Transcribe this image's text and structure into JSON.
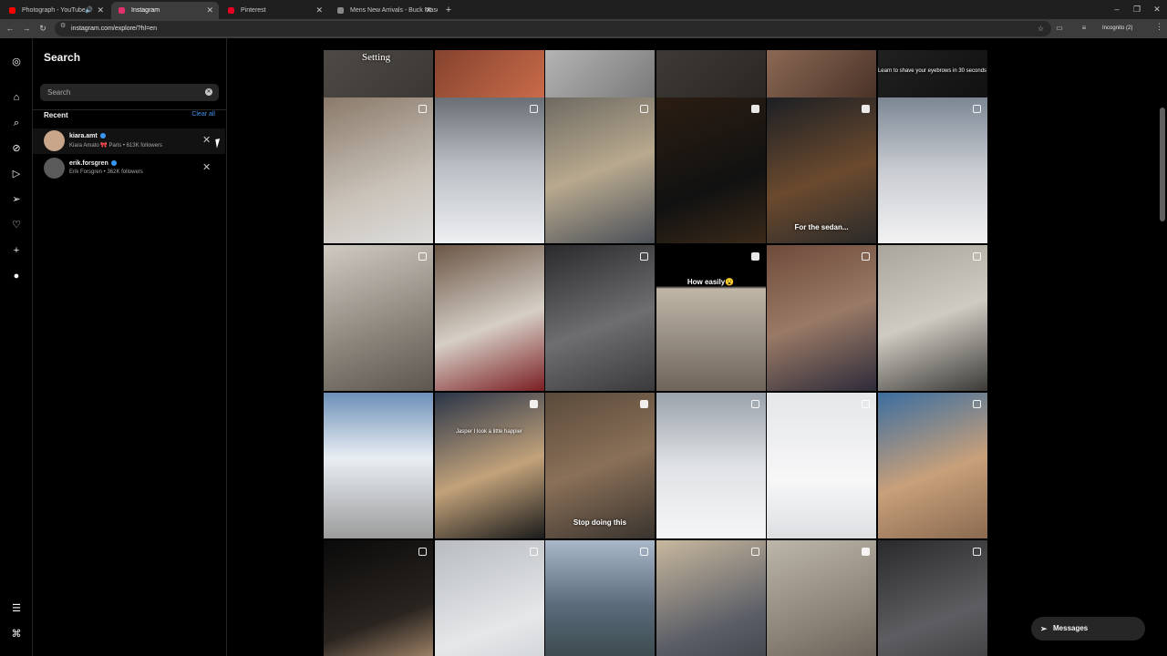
{
  "browser": {
    "tabs": [
      {
        "label": "Photograph - YouTube",
        "favicon_color": "#ff0000",
        "audio": true,
        "active": false
      },
      {
        "label": "Instagram",
        "favicon_color": "#e1306c",
        "audio": false,
        "active": true
      },
      {
        "label": "Pinterest",
        "favicon_color": "#e60023",
        "audio": false,
        "active": false
      },
      {
        "label": "Mens New Arrivals - Buck Mason",
        "favicon_color": "#888888",
        "audio": false,
        "active": false
      }
    ],
    "url": "instagram.com/explore/?hl=en",
    "incognito_label": "Incognito (2)"
  },
  "search": {
    "title": "Search",
    "placeholder": "Search",
    "recent_label": "Recent",
    "clear_all_label": "Clear all",
    "recent": [
      {
        "username": "kiara.amt",
        "subtitle": "Kiara Amato 🎀 Paris • 613K followers",
        "verified": true,
        "avatar_color": "#c9a58a"
      },
      {
        "username": "erik.forsgren",
        "subtitle": "Erik Forsgren • 362K followers",
        "verified": true,
        "avatar_color": "#5a5a5a"
      }
    ]
  },
  "rail_icons": [
    "instagram-icon",
    "home-icon",
    "search-icon",
    "explore-icon",
    "reels-icon",
    "messages-icon",
    "notifications-icon",
    "create-icon",
    "profile-icon"
  ],
  "grid": {
    "tiles": [
      {
        "caption": "Setting",
        "badge": "none",
        "bg": "linear-gradient(135deg,#5a5550,#3b3733)"
      },
      {
        "caption": "",
        "badge": "none",
        "bg": "linear-gradient(135deg,#5a2a1c,#c96b4a)"
      },
      {
        "caption": "",
        "badge": "none",
        "bg": "linear-gradient(135deg,#d8d8d8,#7a7a7a)"
      },
      {
        "caption": "",
        "badge": "none",
        "bg": "linear-gradient(135deg,#4a4540,#2a2725)"
      },
      {
        "caption": "",
        "badge": "none",
        "bg": "linear-gradient(135deg,#b48a70,#4a3328)"
      },
      {
        "caption": "Learn to shave your eyebrows in 30 seconds",
        "badge": "none",
        "bg": "linear-gradient(135deg,#2a2a2a,#111)"
      },
      {
        "caption": "",
        "badge": "multi",
        "bg": "linear-gradient(160deg,#8a7a6a,#c9c2b8 60%,#ddd 100%)"
      },
      {
        "caption": "",
        "badge": "multi",
        "bg": "linear-gradient(180deg,#6a6f76,#b8bcc2 45%,#eef0f2 100%)"
      },
      {
        "caption": "",
        "badge": "multi",
        "bg": "linear-gradient(160deg,#6e6a62,#b8a98e 50%,#4b5058 100%)"
      },
      {
        "caption": "",
        "badge": "reel",
        "bg": "linear-gradient(160deg,#2b1d12,#111 60%,#3a2a1a)"
      },
      {
        "caption": "For the sedan...",
        "badge": "reel",
        "bg": "linear-gradient(160deg,#1c1f24,#6b4a2e 55%,#2a2a2a)"
      },
      {
        "caption": "",
        "badge": "multi",
        "bg": "linear-gradient(180deg,#7c8794,#c9ccd2 50%,#f2f2f2 100%)"
      },
      {
        "caption": "",
        "badge": "multi",
        "bg": "linear-gradient(160deg,#cfcac2,#8a837a 60%,#5d564f)"
      },
      {
        "caption": "",
        "badge": "none",
        "bg": "linear-gradient(160deg,#6b5646,#d6cfc6 55%,#7b1e22 100%)"
      },
      {
        "caption": "",
        "badge": "multi",
        "bg": "linear-gradient(160deg,#2a2a2c,#6e6e70 55%,#3a3a3c)"
      },
      {
        "caption": "How easily😮",
        "badge": "reel",
        "bg": "linear-gradient(180deg,#000 0%,#000 28%,#bfb6a8 30%,#6e645a 100%)"
      },
      {
        "caption": "",
        "badge": "multi",
        "bg": "linear-gradient(160deg,#6e4a3a,#9a7a66 50%,#2e2b3a 100%)"
      },
      {
        "caption": "",
        "badge": "multi",
        "bg": "linear-gradient(160deg,#a9a59c,#cfcbc2 50%,#3c3a38 100%)"
      },
      {
        "caption": "",
        "badge": "none",
        "bg": "linear-gradient(180deg,#6d90b8,#e9eef3 45%,#9c9c9c 100%)"
      },
      {
        "caption": "Jasper I look a little happier",
        "badge": "reel",
        "bg": "linear-gradient(160deg,#2a3548,#c2a27a 55%,#1b1b1b 100%)"
      },
      {
        "caption": "Stop doing this",
        "badge": "reel",
        "bg": "linear-gradient(160deg,#5a4a3a,#8a7058 50%,#3a342e 100%)"
      },
      {
        "caption": "",
        "badge": "multi",
        "bg": "linear-gradient(180deg,#9aa2ab,#dfe2e5 50%,#f5f6f7 100%)"
      },
      {
        "caption": "",
        "badge": "multi",
        "bg": "linear-gradient(180deg,#e4e6e9,#f7f7f8 60%,#dcdfe2 100%)"
      },
      {
        "caption": "",
        "badge": "multi",
        "bg": "linear-gradient(160deg,#3b6ea0,#c8a07a 55%,#8a6a50 100%)"
      },
      {
        "caption": "",
        "badge": "multi",
        "bg": "linear-gradient(160deg,#0a0a0a,#2a2420 55%,#d9b28a 100%)"
      },
      {
        "caption": "",
        "badge": "multi",
        "bg": "linear-gradient(160deg,#b8bcc0,#e5e7e9 60%,#c8ccd0 100%)"
      },
      {
        "caption": "",
        "badge": "multi",
        "bg": "linear-gradient(180deg,#a9b8c8,#5a6a7a 45%,#2c3a36 100%)"
      },
      {
        "caption": "",
        "badge": "multi",
        "bg": "linear-gradient(160deg,#c8b89e,#5a5d66 60%,#3a3c42 100%)"
      },
      {
        "caption": "",
        "badge": "reel",
        "bg": "linear-gradient(160deg,#bdb6aa,#8a8276 55%,#5a5249 100%)"
      },
      {
        "caption": "",
        "badge": "multi",
        "bg": "linear-gradient(160deg,#2a2a2c,#5e5e62 55%,#353538)"
      }
    ]
  },
  "messages_label": "Messages"
}
